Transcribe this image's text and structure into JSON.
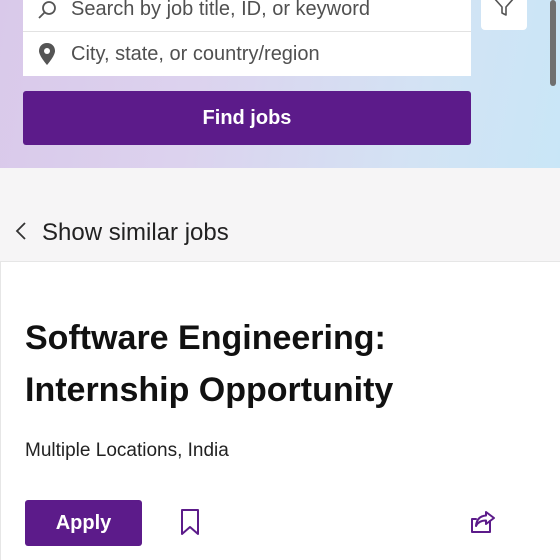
{
  "search": {
    "keyword_placeholder": "Search by job title, ID, or keyword",
    "location_placeholder": "City, state, or country/region",
    "find_label": "Find jobs"
  },
  "nav": {
    "similar_label": "Show similar jobs"
  },
  "job": {
    "title_line1": "Software Engineering:",
    "title_line2": "Internship Opportunity",
    "location": "Multiple Locations, India",
    "apply_label": "Apply"
  },
  "icons": {
    "search": "search-icon",
    "location": "location-pin-icon",
    "filter": "filter-icon",
    "back": "chevron-left-icon",
    "save": "bookmark-icon",
    "share": "share-icon"
  },
  "colors": {
    "accent": "#5c1b8a",
    "hero_start": "#d9c9ea",
    "hero_end": "#c9e6f7"
  }
}
